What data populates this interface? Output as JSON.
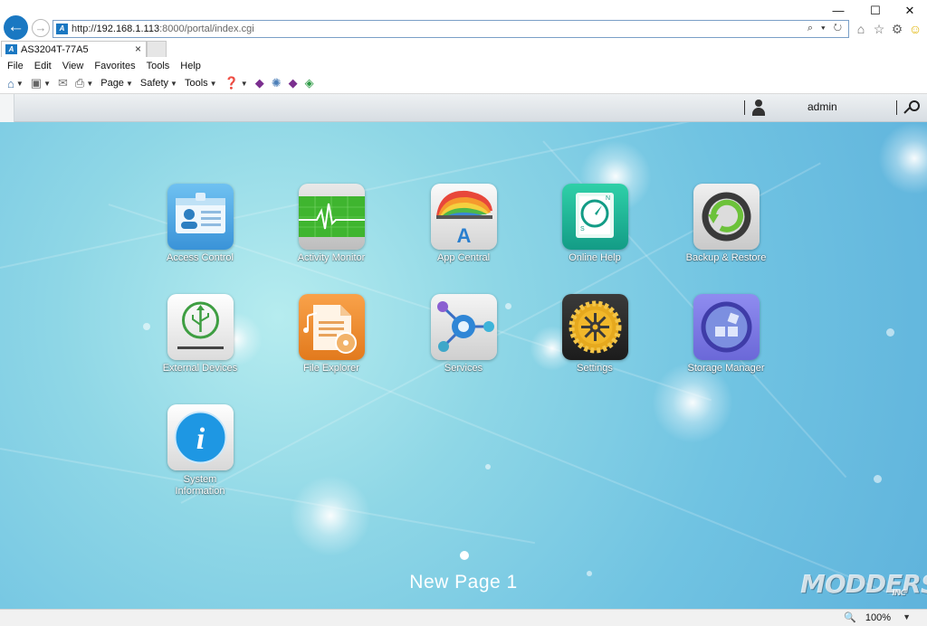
{
  "browser": {
    "url": {
      "scheme": "http://",
      "host": "192.168.1.113",
      "path": ":8000/portal/index.cgi"
    },
    "address_controls": "⌕ ▾ ↻",
    "tab": {
      "title": "AS3204T-77A5",
      "favicon": "A",
      "close": "×"
    },
    "window_controls": {
      "minimize": "—",
      "maximize": "☐",
      "close": "✕"
    },
    "right_icons": {
      "home": "⌂",
      "favorites": "☆",
      "settings": "⚙",
      "feedback": "☺"
    },
    "menu": [
      "File",
      "Edit",
      "View",
      "Favorites",
      "Tools",
      "Help"
    ],
    "command_bar": {
      "page": "Page",
      "safety": "Safety",
      "tools": "Tools"
    },
    "status": {
      "zoom": "100%"
    }
  },
  "portal": {
    "user": "admin",
    "apps": [
      {
        "label": "Access Control"
      },
      {
        "label": "Activity Monitor"
      },
      {
        "label": "App Central"
      },
      {
        "label": "Online Help"
      },
      {
        "label": "Backup & Restore"
      },
      {
        "label": "External Devices"
      },
      {
        "label": "File Explorer"
      },
      {
        "label": "Services"
      },
      {
        "label": "Settings"
      },
      {
        "label": "Storage Manager"
      },
      {
        "label": "System Information"
      }
    ],
    "page_name": "New Page 1"
  },
  "watermark": {
    "brand": "MODDERS",
    "suffix": "INC"
  },
  "colors": {
    "accent": "#1a78c2",
    "desktop": "#70c3e2"
  }
}
